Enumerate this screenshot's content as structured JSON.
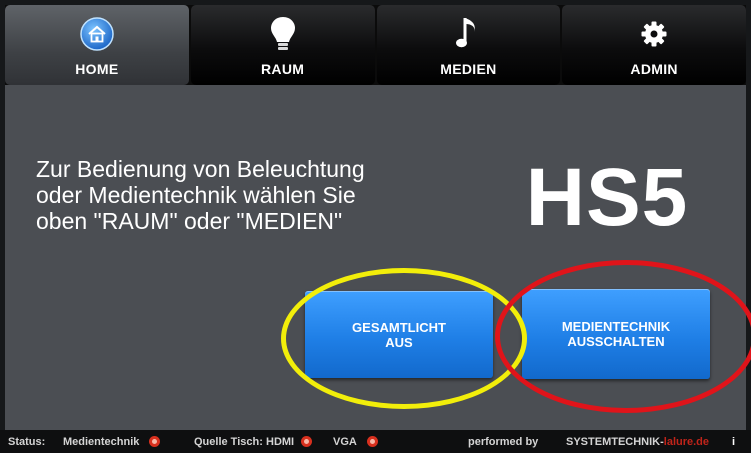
{
  "nav": {
    "tabs": [
      {
        "label": "HOME",
        "icon": "home-icon",
        "active": true
      },
      {
        "label": "RAUM",
        "icon": "lightbulb-icon",
        "active": false
      },
      {
        "label": "MEDIEN",
        "icon": "music-note-icon",
        "active": false
      },
      {
        "label": "ADMIN",
        "icon": "gear-icon",
        "active": false
      }
    ]
  },
  "main": {
    "hint_lines": [
      "Zur Bedienung von Beleuchtung",
      "oder Medientechnik wählen Sie",
      "oben \"RAUM\" oder \"MEDIEN\""
    ],
    "room_id": "HS5"
  },
  "actions": {
    "light_off": {
      "line1": "GESAMTLICHT",
      "line2": "AUS"
    },
    "media_off": {
      "line1": "MEDIENTECHNIK",
      "line2": "AUSSCHALTEN"
    }
  },
  "annotations": {
    "yellow_color": "#f2ee0a",
    "red_color": "#e0141a"
  },
  "status_bar": {
    "status_label": "Status:",
    "media_label": "Medientechnik",
    "source_label": "Quelle Tisch:",
    "hdmi_label": "HDMI",
    "vga_label": "VGA",
    "performed_by": "performed by",
    "brand": "SYSTEMTECHNIK-",
    "brand_suffix": "lalure.de",
    "info": "i",
    "indicator_color": "#d8301e"
  },
  "colors": {
    "button_blue": "#1f7fe6",
    "background": "#4b4e53"
  }
}
